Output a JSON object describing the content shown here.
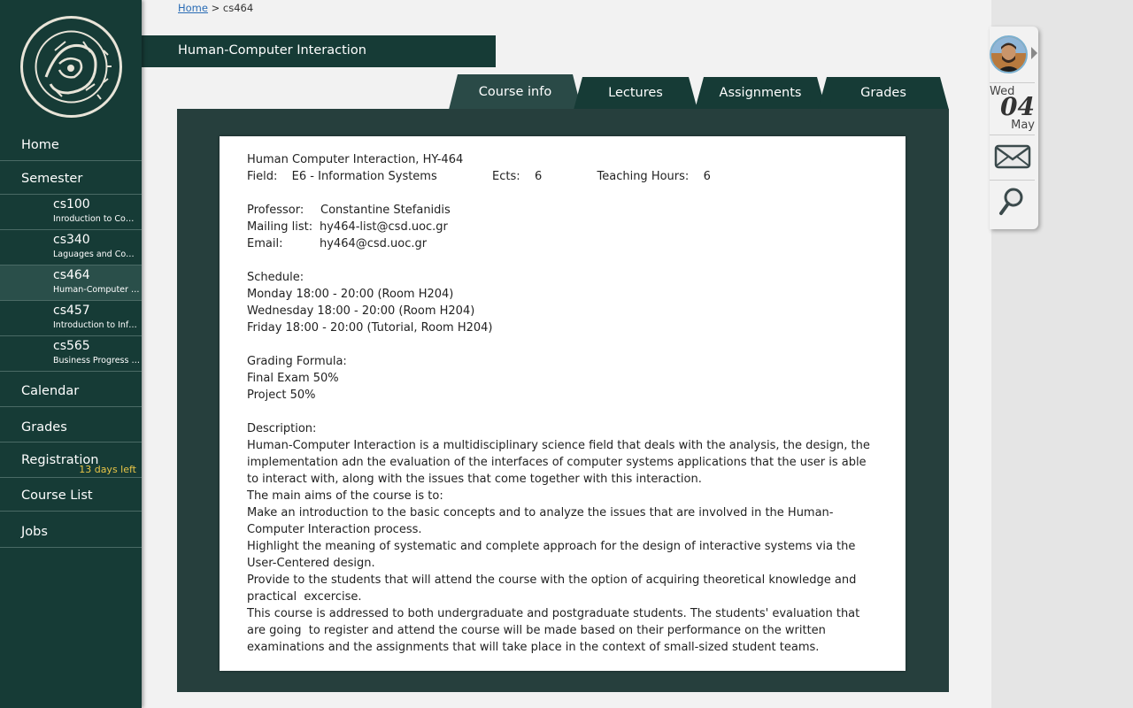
{
  "sidebar": {
    "nav": {
      "home": "Home",
      "semester": "Semester",
      "calendar": "Calendar",
      "grades": "Grades",
      "registration": "Registration",
      "registration_badge": "13 days left",
      "course_list": "Course List",
      "jobs": "Jobs"
    },
    "courses": [
      {
        "code": "cs100",
        "title": "Inroduction to Computer Science"
      },
      {
        "code": "cs340",
        "title": "Laguages and Compilers"
      },
      {
        "code": "cs464",
        "title": "Human-Computer Interaction"
      },
      {
        "code": "cs457",
        "title": "Introduction to Information Systems"
      },
      {
        "code": "cs565",
        "title": "Business Progress Management"
      }
    ],
    "active_course": "cs464"
  },
  "breadcrumb": {
    "home": "Home",
    "separator": ">",
    "current": "cs464"
  },
  "page_title": "Human-Computer Interaction",
  "tabs": [
    {
      "label": "Course info",
      "active": true
    },
    {
      "label": "Lectures",
      "active": false
    },
    {
      "label": "Assignments",
      "active": false
    },
    {
      "label": "Grades",
      "active": false
    }
  ],
  "course_info": {
    "heading": "Human Computer Interaction, HY-464",
    "field_label": "Field:",
    "field_value": "E6 - Information Systems",
    "ects_label": "Ects:",
    "ects_value": "6",
    "hours_label": "Teaching Hours:",
    "hours_value": "6",
    "professor_label": "Professor:",
    "professor_value": "Constantine Stefanidis",
    "mailing_label": "Mailing list:",
    "mailing_value": "hy464-list@csd.uoc.gr",
    "email_label": "Email:",
    "email_value": "hy464@csd.uoc.gr",
    "schedule_label": "Schedule:",
    "schedule": [
      "Monday 18:00 - 20:00 (Room H204)",
      "Wednesday 18:00 - 20:00 (Room H204)",
      "Friday 18:00 - 20:00 (Tutorial, Room H204)"
    ],
    "grading_label": "Grading Formula:",
    "grading": [
      "Final Exam 50%",
      "Project 50%"
    ],
    "description_label": "Description:",
    "description": [
      "Human-Computer Interaction is a multidisciplinary science field that deals with the analysis, the design, the implementation adn the evaluation of the interfaces of computer systems applications that the user is able to interact with, along with the issues that come together with this interaction.",
      "The main aims of the course is to:",
      "Make an introduction to the basic concepts and to analyze the issues that are involved in the Human-Computer Interaction process.",
      "Highlight the meaning of systematic and complete approach for the design of interactive systems via the User-Centered design.",
      "Provide to the students that will attend the course with the option of acquiring theoretical knowledge and practical  excercise.",
      "This course is addressed to both undergraduate and postgraduate students. The students' evaluation that are going  to register and attend the course will be made based on their performance on the written examinations and the assignments that will take place in the context of small-sized student teams."
    ]
  },
  "widget": {
    "day": "Wed",
    "date": "04",
    "month": "May",
    "mail_icon": "mail-icon",
    "search_icon": "search-icon"
  },
  "colors": {
    "sidebar_bg": "#163b36",
    "frame_bg": "#263f3d",
    "badge": "#e8c547",
    "link": "#2a6cb5"
  }
}
